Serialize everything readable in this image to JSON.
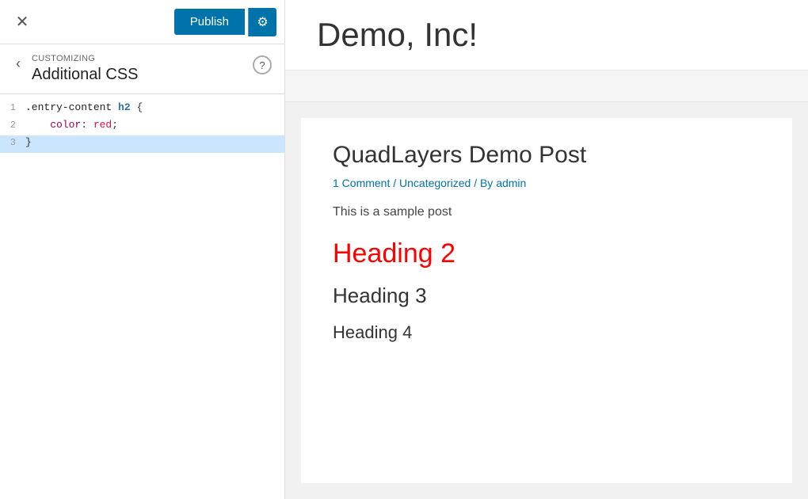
{
  "topBar": {
    "closeLabel": "✕",
    "publishLabel": "Publish",
    "settingsIcon": "⚙"
  },
  "breadcrumb": {
    "backIcon": "‹",
    "customizingLabel": "Customizing",
    "sectionTitle": "Additional CSS",
    "helpIcon": "?"
  },
  "codeEditor": {
    "lines": [
      {
        "number": "1",
        "content": ".entry-content h2 {",
        "highlight": false
      },
      {
        "number": "2",
        "content": "    color: red;",
        "highlight": false
      },
      {
        "number": "3",
        "content": "}",
        "highlight": true
      }
    ]
  },
  "preview": {
    "siteTitle": "Demo, Inc!",
    "postTitle": "QuadLayers Demo Post",
    "postMeta": "1 Comment / Uncategorized / By admin",
    "postExcerpt": "This is a sample post",
    "heading2": "Heading 2",
    "heading3": "Heading 3",
    "heading4": "Heading 4"
  }
}
